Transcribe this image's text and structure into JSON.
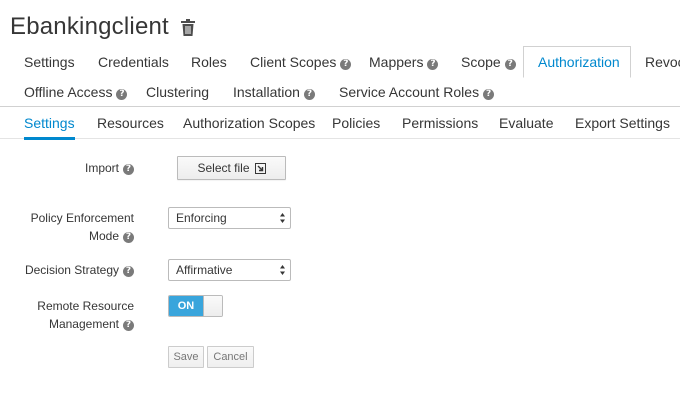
{
  "header": {
    "title": "Ebankingclient",
    "delete_icon": "trash-icon"
  },
  "tabs": [
    {
      "label": "Settings",
      "help": false,
      "active": false
    },
    {
      "label": "Credentials",
      "help": false,
      "active": false
    },
    {
      "label": "Roles",
      "help": false,
      "active": false
    },
    {
      "label": "Client Scopes",
      "help": true,
      "active": false
    },
    {
      "label": "Mappers",
      "help": true,
      "active": false
    },
    {
      "label": "Scope",
      "help": true,
      "active": false
    },
    {
      "label": "Authorization",
      "help": false,
      "active": true
    },
    {
      "label": "Revoca",
      "help": false,
      "active": false
    },
    {
      "label": "Offline Access",
      "help": true,
      "active": false
    },
    {
      "label": "Clustering",
      "help": false,
      "active": false
    },
    {
      "label": "Installation",
      "help": true,
      "active": false
    },
    {
      "label": "Service Account Roles",
      "help": true,
      "active": false
    }
  ],
  "subtabs": [
    {
      "label": "Settings",
      "active": true
    },
    {
      "label": "Resources",
      "active": false
    },
    {
      "label": "Authorization Scopes",
      "active": false
    },
    {
      "label": "Policies",
      "active": false
    },
    {
      "label": "Permissions",
      "active": false
    },
    {
      "label": "Evaluate",
      "active": false
    },
    {
      "label": "Export Settings",
      "active": false
    }
  ],
  "form": {
    "import": {
      "label": "Import",
      "button": "Select file"
    },
    "policy_enforcement": {
      "label_line1": "Policy Enforcement",
      "label_line2": "Mode",
      "value": "Enforcing"
    },
    "decision_strategy": {
      "label": "Decision Strategy",
      "value": "Affirmative"
    },
    "remote_resource": {
      "label_line1": "Remote Resource",
      "label_line2": "Management",
      "toggle": "ON"
    },
    "save_label": "Save",
    "cancel_label": "Cancel"
  },
  "colors": {
    "accent": "#0088ce",
    "toggle_on": "#39a5dc"
  }
}
